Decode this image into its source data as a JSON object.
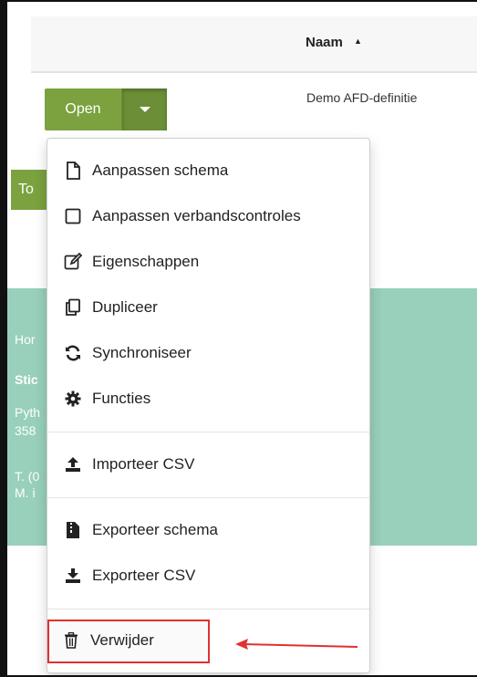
{
  "table": {
    "column_name": "Naam",
    "row_name": "Demo AFD-definitie"
  },
  "actions": {
    "open_label": "Open",
    "behind_button_label": "To"
  },
  "footer": {
    "line1": "Hor",
    "line2": "Stic",
    "line3": "Pyth",
    "line4": "358",
    "line5": "T. (0",
    "line6": "M. i"
  },
  "menu": {
    "items": [
      {
        "label": "Aanpassen schema",
        "icon": "file-icon"
      },
      {
        "label": "Aanpassen verbandscontroles",
        "icon": "square-icon"
      },
      {
        "label": "Eigenschappen",
        "icon": "edit-icon"
      },
      {
        "label": "Dupliceer",
        "icon": "copy-icon"
      },
      {
        "label": "Synchroniseer",
        "icon": "sync-icon"
      },
      {
        "label": "Functies",
        "icon": "gear-icon"
      },
      {
        "label": "Importeer CSV",
        "icon": "upload-icon"
      },
      {
        "label": "Exporteer schema",
        "icon": "zip-file-icon"
      },
      {
        "label": "Exporteer CSV",
        "icon": "download-icon"
      },
      {
        "label": "Verwijder",
        "icon": "trash-icon"
      }
    ]
  },
  "colors": {
    "primary_green": "#7ba23f",
    "footer_teal": "#98d0bb",
    "highlight_red": "#e0322e"
  }
}
